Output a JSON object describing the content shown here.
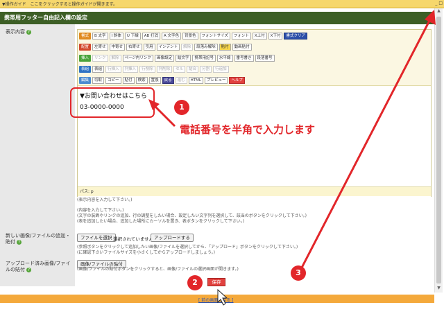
{
  "top_bar": {
    "hint": "▼操作ガイド　ここをクリックすると操作ガイドが開きます。",
    "window_buttons": "_ □"
  },
  "panel_title": "携帯用フッター自由記入欄の設定",
  "labels": {
    "display_content": "表示内容",
    "new_file": "新しい画像/ファイルの追加・貼付",
    "uploaded_file": "アップロード済み画像/ファイルの貼付"
  },
  "toolbar": {
    "row1_group": "書式",
    "row1_buttons": [
      "B 太字",
      "I 斜体",
      "U 下線",
      "AB 打消",
      "A 文字色",
      "背景色"
    ],
    "font_size": "フォントサイズ",
    "font": "フォント",
    "row1_tail": [
      "X上付",
      "X下付",
      "書式クリア"
    ],
    "row2_group": "配置",
    "row2_buttons": [
      "左寄せ",
      "中寄せ",
      "右寄せ",
      "引用",
      "インデント",
      "解除",
      "段落み解除",
      "貼付",
      "動画貼付"
    ],
    "row3_group": "挿入",
    "row3_buttons": [
      "リンク",
      "解除",
      "ページ内リンク",
      "画像設定",
      "絵文字",
      "携帯用記号",
      "水平線",
      "番号書き",
      "段落番号"
    ],
    "row4_group": "表組",
    "row4_buttons": [
      "表組",
      "行挿入",
      "列挿入",
      "行削除",
      "列削除",
      "セル",
      "結合",
      "分割",
      "行追加"
    ],
    "row5_group": "編集",
    "row5_buttons": [
      "切取",
      "コピー",
      "貼付",
      "検索",
      "置換",
      "戻る",
      "進む",
      "HTML",
      "プレビュー",
      "ヘルプ"
    ]
  },
  "editor": {
    "line1": "▼お問い合わせはこちら",
    "line2": "03-0000-0000",
    "path": "パス: p"
  },
  "notes": {
    "n1": "(表示内容を入力して下さい。)",
    "n2": "(内容を入力して下さい。)",
    "n3": "(文字の装飾やリンクの追加、行の調整をしたい場合、設定したい文字列を選択して、該当のボタンをクリックして下さい。)",
    "n4": "(表を追加したい場合、追加した場所にカーソルを置き、表ボタンをクリックして下さい。)",
    "n5": "(参照ボタンをクリックして追加したい画像/ファイルを選択してから、「アップロード」ボタンをクリックして下さい。)",
    "n6": "(に確認下さいファイルサイズを小さくしてからアップロードしましょう。)",
    "n7": "(画像/ファイルの貼付ボタンをクリックすると、画像/ファイルの選択画面が開きます。)"
  },
  "controls": {
    "choose_file": "ファイルを選択",
    "no_file": "選択されていません",
    "upload": "アップロードする",
    "paste_file": "画像/ファイルの貼付",
    "save": "保存",
    "back_link": "[ 前の画面に戻る ]"
  },
  "annotations": {
    "badge1": "1",
    "badge2": "2",
    "badge3": "3",
    "callout": "電話番号を半角で入力します"
  },
  "colors": {
    "header_green": "#3d5f26",
    "accent_red": "#e2262a",
    "top_yellow": "#f6d76c",
    "bottom_orange": "#f4a93b"
  }
}
